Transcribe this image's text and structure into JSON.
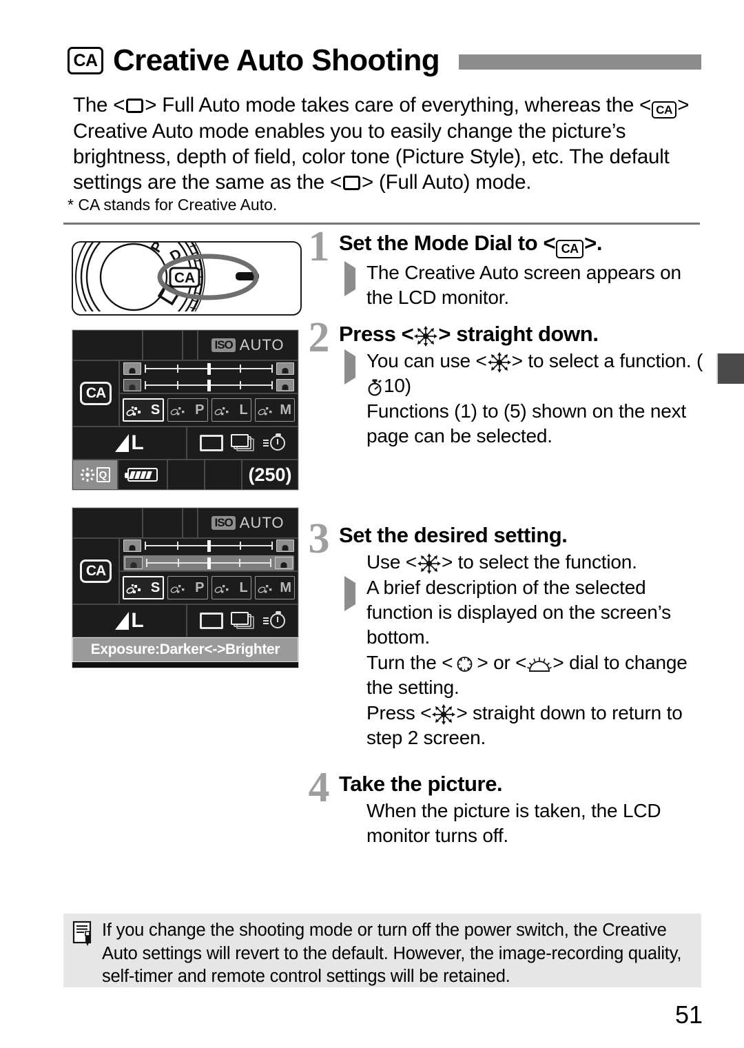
{
  "header": {
    "mode_badge": "CA",
    "title": "Creative Auto Shooting"
  },
  "intro": {
    "line1_a": "The <",
    "line1_b": "> Full Auto mode takes care of everything, whereas the <",
    "line1_c": ">",
    "line2": "Creative Auto mode enables you to easily change the picture’s",
    "line3": "brightness, depth of field, color tone (Picture Style), etc. The default",
    "line4_a": "settings are the same as the <",
    "line4_b": "> (Full Auto) mode.",
    "footnote": "* CA stands for Creative Auto."
  },
  "steps": [
    {
      "num": "1",
      "head_a": "Set the Mode Dial to <",
      "head_b": ">.",
      "bullets": [
        {
          "marker": "triangle",
          "text": "The Creative Auto screen appears on the LCD monitor."
        }
      ]
    },
    {
      "num": "2",
      "head_a": "Press <",
      "head_b": "> straight down.",
      "bullets": [
        {
          "marker": "triangle",
          "text_a": "You can use <",
          "text_b": "> to select a function. (",
          "timer_value": "10",
          "text_c": ")"
        },
        {
          "marker": "dot",
          "text": "Functions (1) to (5) shown on the next page can be selected."
        }
      ]
    },
    {
      "num": "3",
      "head": "Set the desired setting.",
      "bullets": [
        {
          "marker": "dot",
          "text_a": "Use <",
          "text_b": "> to select the function."
        },
        {
          "marker": "triangle",
          "text": "A brief description of the selected function is displayed on the screen’s bottom."
        },
        {
          "marker": "dot",
          "text_a": "Turn the <",
          "text_b": "> or <",
          "text_c": "> dial to change the setting."
        },
        {
          "marker": "dot",
          "text_a": "Press <",
          "text_b": "> straight down to return to step 2 screen."
        }
      ]
    },
    {
      "num": "4",
      "head": "Take the picture.",
      "bullets": [
        {
          "marker": "dot",
          "text": "When the picture is taken, the LCD monitor turns off."
        }
      ]
    }
  ],
  "mode_dial_figure": {
    "selected_label": "CA",
    "neighbor_labels": [
      "P",
      "D"
    ]
  },
  "lcd_screen_1": {
    "iso_label": "ISO",
    "iso_value": "AUTO",
    "mode": "CA",
    "picture_styles": [
      "S",
      "P",
      "L",
      "M"
    ],
    "selected_style": "S",
    "quality": "L",
    "drive_icons": [
      "single-shot-icon",
      "continuous-shot-icon",
      "self-timer-icon"
    ],
    "quick_control": "Q",
    "battery": "full",
    "shots_remaining": "(250)"
  },
  "lcd_screen_2": {
    "iso_label": "ISO",
    "iso_value": "AUTO",
    "mode": "CA",
    "picture_styles": [
      "S",
      "P",
      "L",
      "M"
    ],
    "selected_style": "S",
    "quality": "L",
    "drive_icons": [
      "single-shot-icon",
      "continuous-shot-icon",
      "self-timer-icon"
    ],
    "hint_text": "Exposure:Darker<->Brighter"
  },
  "note": {
    "line1": "If you change the shooting mode or turn off the power switch, the Creative",
    "line2": "Auto settings will revert to the default. However, the image-recording quality,",
    "line3": "self-timer and remote control settings will be retained."
  },
  "page_number": "51",
  "colors": {
    "title_bar": "#8c8c8c",
    "step_number": "#9e9e9e",
    "bullet_marker": "#8d8d8d",
    "note_background": "#e6e6e6",
    "rule": "#777777",
    "edge_tab": "#4a4a4a",
    "lcd_background": "#0f0f0f",
    "lcd_cell": "#1c1c1c",
    "lcd_highlight": "#8e8e8e"
  }
}
